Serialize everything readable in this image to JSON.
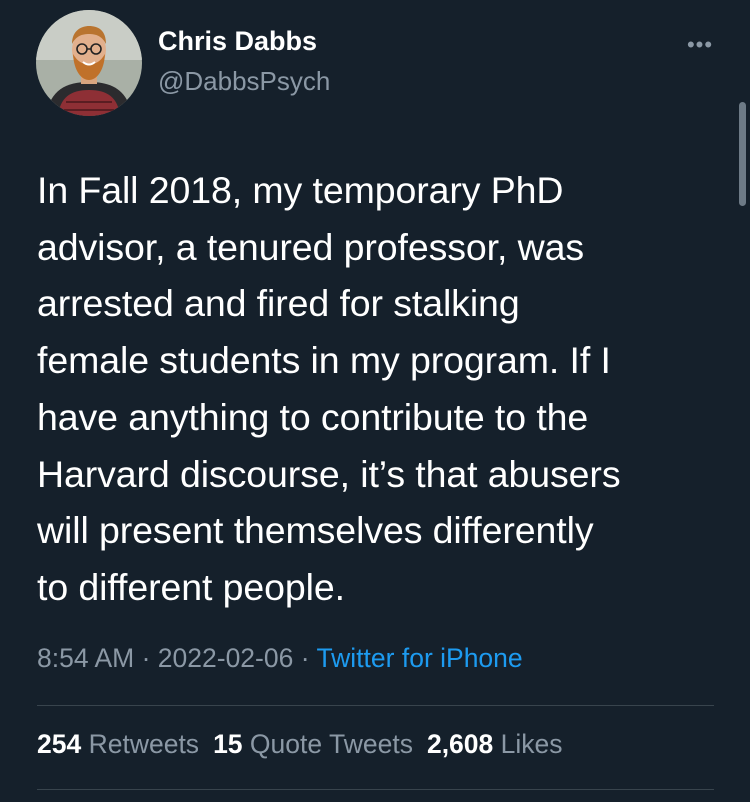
{
  "author": {
    "display_name": "Chris Dabbs",
    "handle": "@DabbsPsych",
    "avatar_icon": "profile-photo"
  },
  "menu": {
    "more_icon": "more-horizontal-icon",
    "more_label": "•••"
  },
  "tweet": {
    "lines": [
      "In Fall 2018, my temporary PhD",
      "advisor, a tenured professor, was",
      "arrested and fired for stalking",
      "female students in my program. If I",
      "have anything to contribute to the",
      "Harvard discourse, it’s that abusers",
      "will present themselves differently",
      "to different people."
    ],
    "time": "8:54 AM",
    "separator": " · ",
    "date": "2022-02-06",
    "source": "Twitter for iPhone"
  },
  "stats": {
    "retweets_count": "254",
    "retweets_label": "Retweets",
    "quotes_count": "15",
    "quotes_label": "Quote Tweets",
    "likes_count": "2,608",
    "likes_label": "Likes"
  },
  "colors": {
    "background": "#15202b",
    "primary_text": "#ffffff",
    "secondary_text": "#8b98a5",
    "link": "#1d9bf0",
    "divider": "#38444d"
  }
}
